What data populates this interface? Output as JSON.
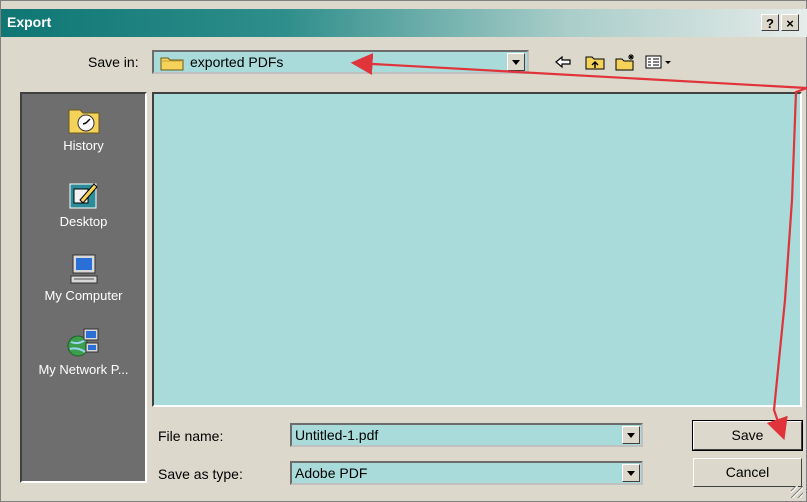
{
  "window": {
    "title": "Export"
  },
  "titlebar_buttons": {
    "help": "?",
    "close": "×"
  },
  "save_in": {
    "label": "Save in:",
    "value": "exported PDFs",
    "icon": "folder-icon"
  },
  "toolbar": {
    "items": [
      "back-icon",
      "up-folder-icon",
      "new-folder-icon",
      "view-menu-icon"
    ]
  },
  "places": [
    {
      "label": "History",
      "icon": "history-icon"
    },
    {
      "label": "Desktop",
      "icon": "desktop-icon"
    },
    {
      "label": "My Computer",
      "icon": "my-computer-icon"
    },
    {
      "label": "My Network P...",
      "icon": "network-places-icon"
    }
  ],
  "file_name": {
    "label": "File name:",
    "value": "Untitled-1.pdf"
  },
  "save_as_type": {
    "label": "Save as type:",
    "value": "Adobe PDF"
  },
  "buttons": {
    "save": "Save",
    "cancel": "Cancel"
  },
  "colors": {
    "field_bg": "#a8dbd9",
    "annotation_arrow": "#e0333a",
    "titlebar": "#0f7674"
  }
}
